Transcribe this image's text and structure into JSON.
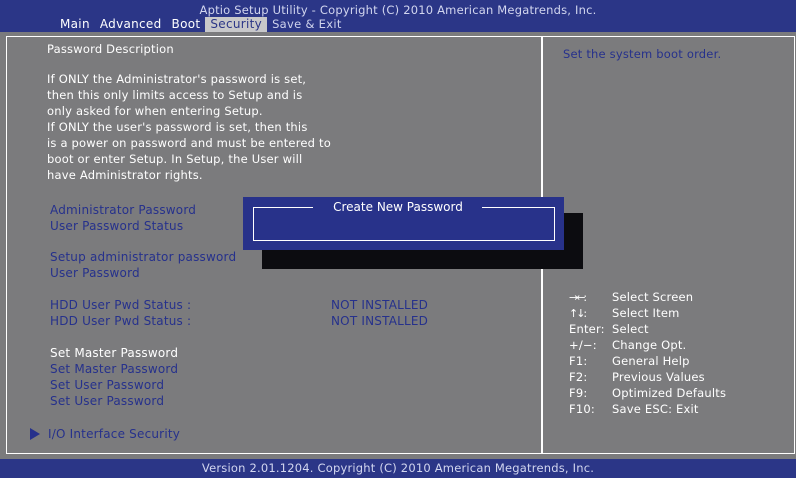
{
  "title": "Aptio Setup Utility - Copyright (C) 2010 American Megatrends, Inc.",
  "menu": [
    {
      "label": "Main"
    },
    {
      "label": "Advanced"
    },
    {
      "label": "Boot"
    },
    {
      "label": "Security"
    },
    {
      "label": "Save & Exit"
    }
  ],
  "description": {
    "heading": "Password Description",
    "lines": [
      "If ONLY the Administrator's password is set,",
      "then this only limits access to Setup and is",
      "only asked for when entering Setup.",
      "If ONLY the user's password is set, then this",
      "is a power on password and must be entered to",
      "boot or enter Setup. In Setup, the User will",
      "have Administrator rights."
    ]
  },
  "items": {
    "admin_password": "Administrator Password",
    "user_password_status": "User Password Status",
    "setup_admin_password": "Setup administrator password",
    "user_password": "User Password",
    "hdd_status_1_label": "HDD User Pwd Status :",
    "hdd_status_1_value": "NOT INSTALLED",
    "hdd_status_2_label": "HDD User Pwd Status :",
    "hdd_status_2_value": "NOT INSTALLED",
    "set_master_1": "Set Master Password",
    "set_master_2": "Set Master Password",
    "set_user_1": "Set User Password",
    "set_user_2": "Set User Password",
    "io_security": "I/O Interface Security"
  },
  "dialog": {
    "title": "Create New Password",
    "value": ""
  },
  "help": "Set the system boot order.",
  "keys": [
    {
      "key": "→←:",
      "desc": "Select Screen",
      "arrow": true
    },
    {
      "key": "↑↓:",
      "desc": "Select Item",
      "arrow": true
    },
    {
      "key": "Enter:",
      "desc": "Select"
    },
    {
      "key": "+/−:",
      "desc": "Change Opt."
    },
    {
      "key": "F1:",
      "desc": "General Help"
    },
    {
      "key": "F2:",
      "desc": "Previous Values"
    },
    {
      "key": "F9:",
      "desc": "Optimized Defaults"
    },
    {
      "key": "F10:",
      "desc": "Save    ESC: Exit"
    }
  ],
  "footer": "Version 2.01.1204. Copyright (C) 2010 American Megatrends, Inc.",
  "colors": {
    "background": "#7b7b7d",
    "header": "#2b3687",
    "selectable_text": "#26318c",
    "highlight_text": "#ffffff"
  }
}
